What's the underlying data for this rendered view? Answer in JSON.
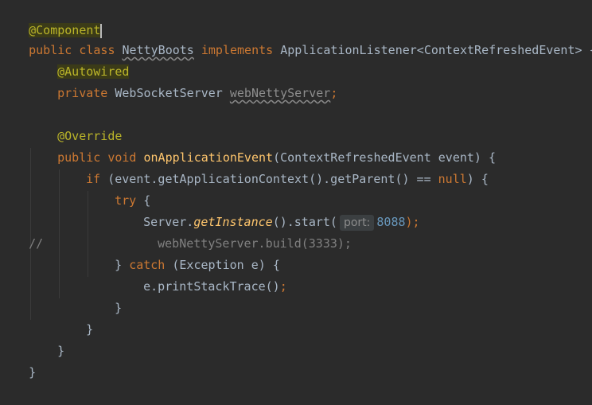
{
  "lines": [
    {
      "annotation": "@Component"
    },
    {
      "kw1": "public",
      "kw2": "class",
      "class_name": "NettyBoots",
      "kw3": "implements",
      "iface": "ApplicationListener<ContextRefreshedEvent>",
      "brace": "{"
    },
    {
      "annotation": "@Autowired"
    },
    {
      "kw": "private",
      "type": "WebSocketServer",
      "field": "webNettyServer",
      "semi": ";"
    },
    {
      "annotation": "@Override"
    },
    {
      "kw1": "public",
      "kw2": "void",
      "method": "onApplicationEvent",
      "params": "(ContextRefreshedEvent event)",
      "brace": "{"
    },
    {
      "kw": "if",
      "cond_a": "(event.getApplicationContext().getParent() ==",
      "null_kw": "null",
      "cond_b": ")",
      "brace": "{"
    },
    {
      "kw": "try",
      "brace": "{"
    },
    {
      "obj": "Server.",
      "call": "getInstance",
      "rest": "().start(",
      "hint": "port:",
      "num": "8088",
      "end": ");"
    },
    {
      "comment_marker": "//",
      "code": "webNettyServer.build(3333);"
    },
    {
      "close": "}",
      "kw": "catch",
      "rest": "(Exception e)",
      "brace": "{"
    },
    {
      "code": "e.printStackTrace()",
      "semi": ";"
    },
    {
      "close": "}"
    },
    {
      "close": "}"
    },
    {
      "close": "}"
    },
    {
      "close": "}"
    }
  ]
}
